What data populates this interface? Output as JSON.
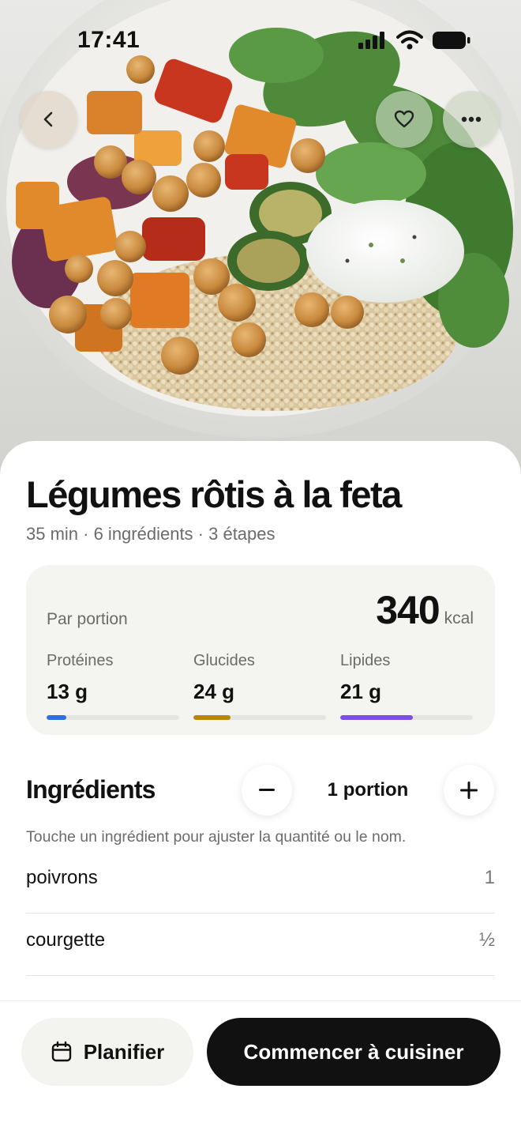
{
  "status_bar": {
    "time": "17:41"
  },
  "hero": {
    "image": "roasted vegetables bowl with chickpeas, couscous, yogurt sauce and salad"
  },
  "header_buttons": {
    "back_icon": "chevron-left-icon",
    "favorite_icon": "heart-icon",
    "more_icon": "ellipsis-icon"
  },
  "recipe": {
    "title": "Légumes rôtis à la feta",
    "meta": "35 min · 6 ingrédients · 3 étapes"
  },
  "nutrition": {
    "per_portion_label": "Par portion",
    "kcal_value": "340",
    "kcal_unit": "kcal",
    "macros": [
      {
        "label": "Protéines",
        "value": "13 g",
        "fill_fraction": 0.15,
        "color": "#2f6fe4"
      },
      {
        "label": "Glucides",
        "value": "24 g",
        "fill_fraction": 0.28,
        "color": "#b8860b"
      },
      {
        "label": "Lipides",
        "value": "21 g",
        "fill_fraction": 0.55,
        "color": "#7b4fe6"
      }
    ]
  },
  "ingredients": {
    "title": "Ingrédients",
    "portion_label": "1 portion",
    "minus_icon": "minus-icon",
    "plus_icon": "plus-icon",
    "hint": "Touche un ingrédient pour ajuster la quantité ou le nom.",
    "items": [
      {
        "name": "poivrons",
        "qty": "1"
      },
      {
        "name": "courgette",
        "qty": "½"
      }
    ]
  },
  "actions": {
    "plan_label": "Planifier",
    "plan_icon": "calendar-icon",
    "cook_label": "Commencer à cuisiner"
  }
}
